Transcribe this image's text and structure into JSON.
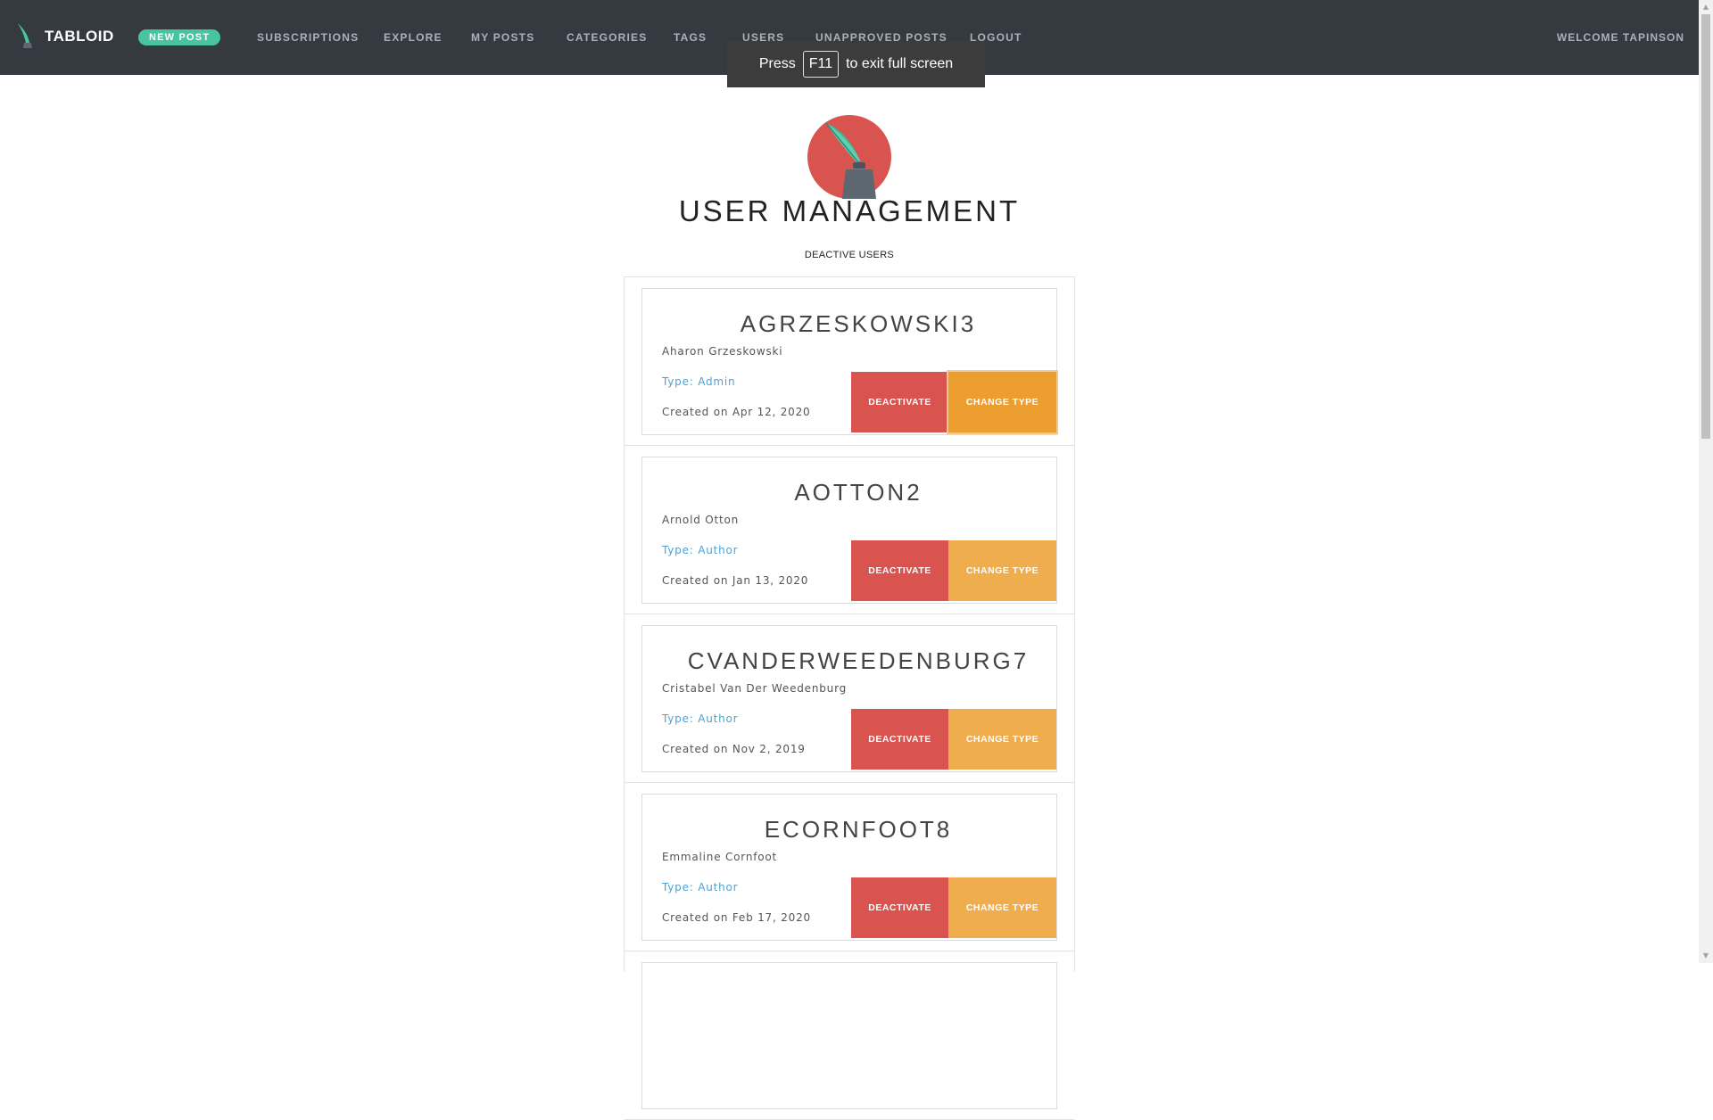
{
  "nav": {
    "brand": "TABLOID",
    "new_post": "NEW POST",
    "links": [
      "SUBSCRIPTIONS",
      "EXPLORE",
      "MY POSTS",
      "CATEGORIES",
      "TAGS",
      "USERS",
      "UNAPPROVED POSTS",
      "LOGOUT"
    ],
    "welcome": "WELCOME TAPINSON"
  },
  "toast": {
    "prefix": "Press",
    "key": "F11",
    "suffix": "to exit full screen"
  },
  "page": {
    "title": "USER MANAGEMENT",
    "deactive_link": "DEACTIVE USERS"
  },
  "users": [
    {
      "username": "AGRZESKOWSKI3",
      "fullname": "Aharon Grzeskowski",
      "type": "Type: Admin",
      "created": "Created on Apr 12, 2020",
      "deactivate_label": "DEACTIVATE",
      "change_type_label": "CHANGE TYPE"
    },
    {
      "username": "AOTTON2",
      "fullname": "Arnold Otton",
      "type": "Type: Author",
      "created": "Created on Jan 13, 2020",
      "deactivate_label": "DEACTIVATE",
      "change_type_label": "CHANGE TYPE"
    },
    {
      "username": "CVANDERWEEDENBURG7",
      "fullname": "Cristabel Van Der Weedenburg",
      "type": "Type: Author",
      "created": "Created on Nov 2, 2019",
      "deactivate_label": "DEACTIVATE",
      "change_type_label": "CHANGE TYPE"
    },
    {
      "username": "ECORNFOOT8",
      "fullname": "Emmaline Cornfoot",
      "type": "Type: Author",
      "created": "Created on Feb 17, 2020",
      "deactivate_label": "DEACTIVATE",
      "change_type_label": "CHANGE TYPE"
    }
  ],
  "colors": {
    "navbar": "#343a40",
    "new_post": "#48c5a0",
    "deactivate": "#d9534f",
    "change_type": "#f0ad4e",
    "type_link": "#4ba3d6"
  },
  "icons": {
    "brand": "quill-icon",
    "logo": "quill-inkwell-logo"
  }
}
